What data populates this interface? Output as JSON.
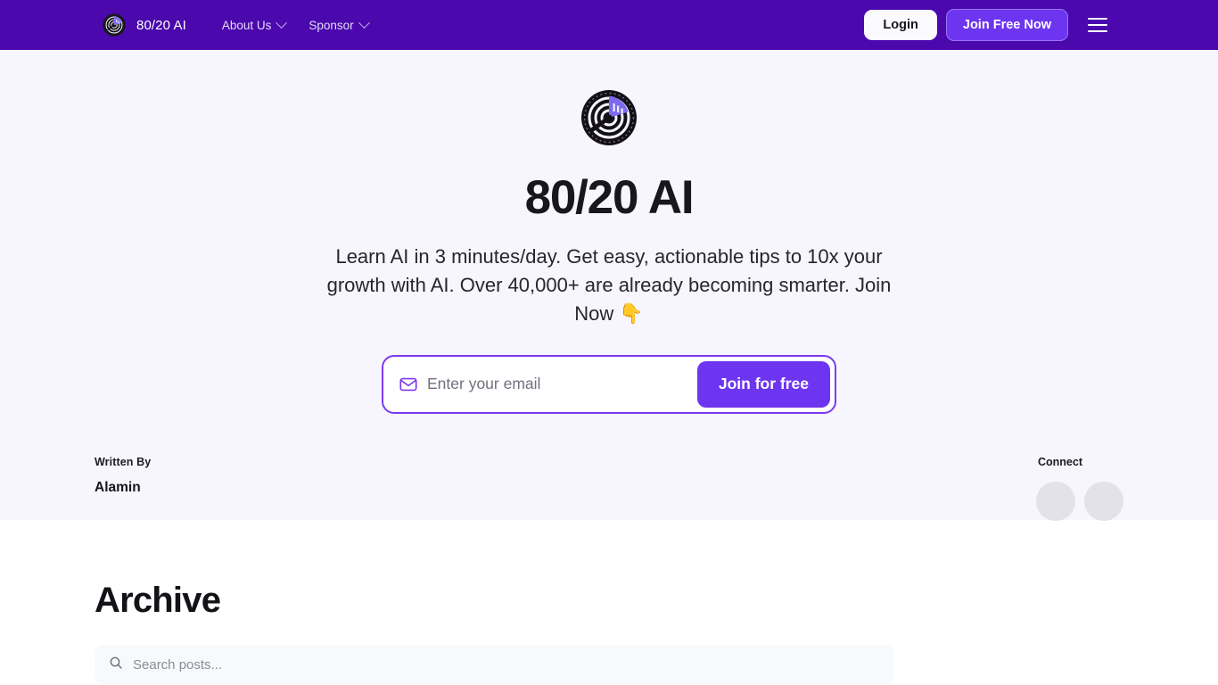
{
  "navbar": {
    "logo_icon": "brand-radar-logo-icon",
    "brand_name": "80/20 AI",
    "links": [
      {
        "label": "About Us",
        "icon": "chevron-down-icon"
      },
      {
        "label": "Sponsor",
        "icon": "chevron-down-icon"
      }
    ],
    "login_label": "Login",
    "join_label": "Join Free Now",
    "menu_icon": "hamburger-menu-icon",
    "background_color": "#4A08AD",
    "join_button_color": "#6D35F0"
  },
  "hero": {
    "logo_icon": "brand-radar-logo-icon",
    "title": "80/20 AI",
    "subtitle": "Learn AI in 3 minutes/day. Get easy, actionable tips to 10x your growth with AI. Over 40,000+ are already becoming smarter. Join Now 👇",
    "background_color": "#F7F5FE",
    "form": {
      "mail_icon": "mail-envelope-icon",
      "email_placeholder": "Enter your email",
      "email_value": "",
      "submit_label": "Join for free",
      "border_color": "#7C3AED",
      "submit_color": "#6D35F0"
    },
    "author": {
      "written_by_label": "Written By",
      "name": "Alamin"
    },
    "connect": {
      "label": "Connect",
      "socials": [
        {
          "icon": "social-placeholder-icon"
        },
        {
          "icon": "social-placeholder-icon"
        }
      ]
    }
  },
  "archive": {
    "title": "Archive",
    "search": {
      "icon": "search-icon",
      "placeholder": "Search posts...",
      "value": ""
    }
  }
}
